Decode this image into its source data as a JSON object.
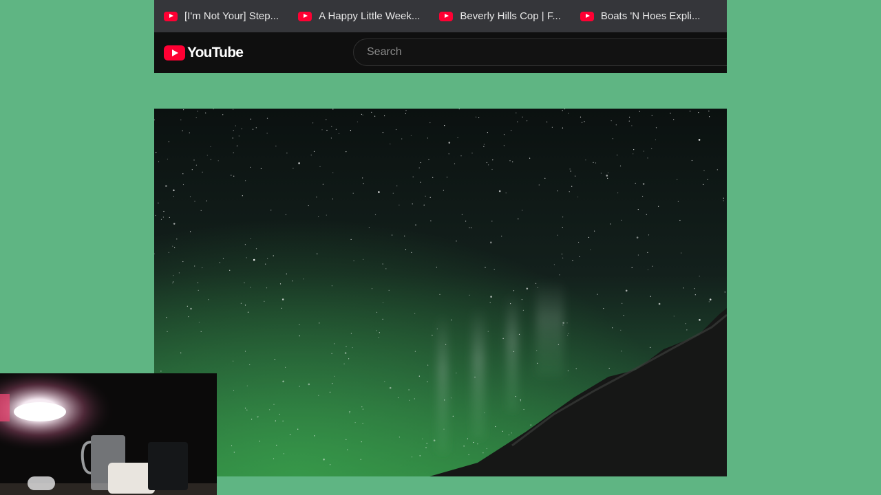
{
  "bookmarks": [
    {
      "label": "[I'm Not Your] Step...",
      "icon": "youtube-favicon"
    },
    {
      "label": "A Happy Little Week...",
      "icon": "youtube-favicon"
    },
    {
      "label": "Beverly Hills Cop | F...",
      "icon": "youtube-favicon"
    },
    {
      "label": "Boats 'N Hoes Expli...",
      "icon": "youtube-favicon"
    }
  ],
  "header": {
    "logo_text": "YouTube",
    "search_placeholder": "Search"
  },
  "colors": {
    "background": "#5fb583",
    "youtube_red": "#ff0033",
    "header_bg": "#0f0f0f",
    "bookmarks_bg": "#35363a"
  }
}
